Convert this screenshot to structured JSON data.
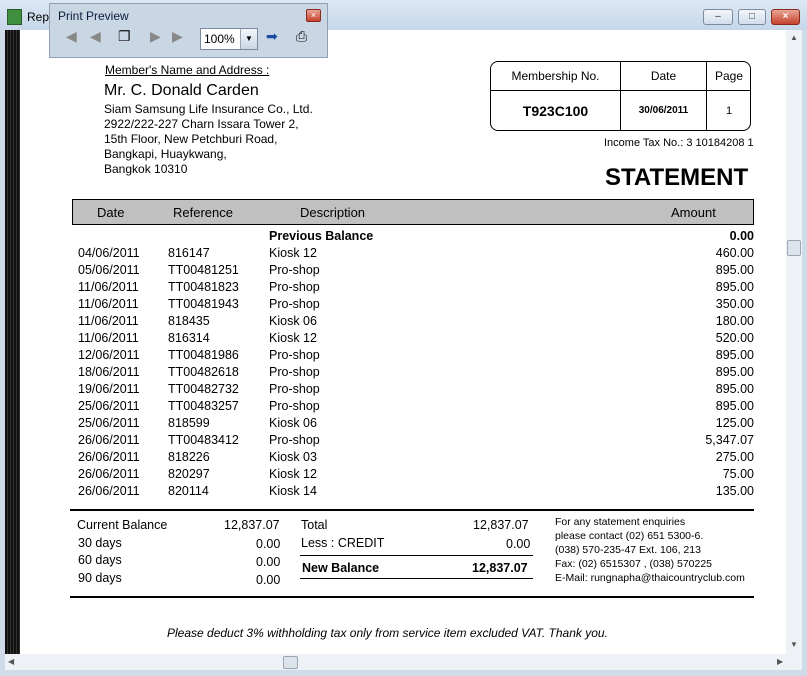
{
  "window": {
    "title": "Rep"
  },
  "print_preview": {
    "title": "Print Preview",
    "zoom": "100%"
  },
  "member": {
    "heading": "Member's Name and Address :",
    "name": "Mr. C. Donald Carden",
    "address": [
      "Siam Samsung Life Insurance Co., Ltd.",
      "2922/222-227 Charn Issara Tower 2,",
      "15th Floor, New Petchburi Road,",
      "Bangkapi, Huaykwang,",
      "Bangkok  10310"
    ]
  },
  "info_box": {
    "membership_label": "Membership No.",
    "date_label": "Date",
    "page_label": "Page",
    "membership_no": "T923C100",
    "date": "30/06/2011",
    "page": "1"
  },
  "income_tax": "Income Tax No.: 3 10184208 1",
  "title": "STATEMENT",
  "columns": {
    "date": "Date",
    "reference": "Reference",
    "description": "Description",
    "amount": "Amount"
  },
  "previous_balance": {
    "label": "Previous Balance",
    "amount": "0.00"
  },
  "transactions": [
    {
      "date": "04/06/2011",
      "ref": "816147",
      "desc": "Kiosk 12",
      "amount": "460.00"
    },
    {
      "date": "05/06/2011",
      "ref": "TT00481251",
      "desc": "Pro-shop",
      "amount": "895.00"
    },
    {
      "date": "11/06/2011",
      "ref": "TT00481823",
      "desc": "Pro-shop",
      "amount": "895.00"
    },
    {
      "date": "11/06/2011",
      "ref": "TT00481943",
      "desc": "Pro-shop",
      "amount": "350.00"
    },
    {
      "date": "11/06/2011",
      "ref": "818435",
      "desc": "Kiosk 06",
      "amount": "180.00"
    },
    {
      "date": "11/06/2011",
      "ref": "816314",
      "desc": "Kiosk 12",
      "amount": "520.00"
    },
    {
      "date": "12/06/2011",
      "ref": "TT00481986",
      "desc": "Pro-shop",
      "amount": "895.00"
    },
    {
      "date": "18/06/2011",
      "ref": "TT00482618",
      "desc": "Pro-shop",
      "amount": "895.00"
    },
    {
      "date": "19/06/2011",
      "ref": "TT00482732",
      "desc": "Pro-shop",
      "amount": "895.00"
    },
    {
      "date": "25/06/2011",
      "ref": "TT00483257",
      "desc": "Pro-shop",
      "amount": "895.00"
    },
    {
      "date": "25/06/2011",
      "ref": "818599",
      "desc": "Kiosk 06",
      "amount": "125.00"
    },
    {
      "date": "26/06/2011",
      "ref": "TT00483412",
      "desc": "Pro-shop",
      "amount": "5,347.07"
    },
    {
      "date": "26/06/2011",
      "ref": "818226",
      "desc": "Kiosk 03",
      "amount": "275.00"
    },
    {
      "date": "26/06/2011",
      "ref": "820297",
      "desc": "Kiosk 12",
      "amount": "75.00"
    },
    {
      "date": "26/06/2011",
      "ref": "820114",
      "desc": "Kiosk 14",
      "amount": "135.00"
    }
  ],
  "aging": [
    {
      "label": "Current Balance",
      "amount": "12,837.07"
    },
    {
      "label": "30 days",
      "amount": "0.00"
    },
    {
      "label": "60 days",
      "amount": "0.00"
    },
    {
      "label": "90 days",
      "amount": "0.00"
    }
  ],
  "totals": {
    "total_label": "Total",
    "total": "12,837.07",
    "credit_label": "Less : CREDIT",
    "credit": "0.00",
    "new_balance_label": "New Balance",
    "new_balance": "12,837.07"
  },
  "contact": [
    "For any statement enquiries",
    "please contact (02) 651 5300-6.",
    "(038) 570-235-47 Ext. 106, 213",
    "Fax: (02) 6515307 , (038) 570225",
    "E-Mail: rungnapha@thaicountryclub.com"
  ],
  "footer": "Please deduct 3% withholding tax only from service item excluded VAT.       Thank you."
}
